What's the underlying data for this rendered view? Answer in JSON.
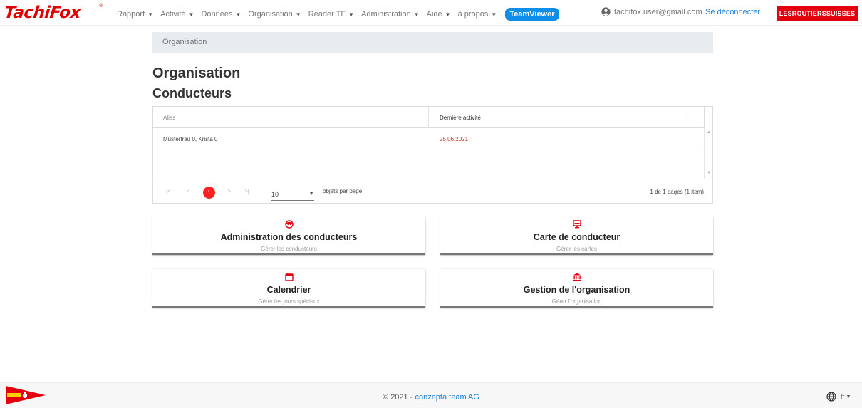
{
  "app": {
    "logo_text": "TachiFox",
    "logo_mark": "®"
  },
  "nav": {
    "items": [
      {
        "label": "Rapport"
      },
      {
        "label": "Activité"
      },
      {
        "label": "Données"
      },
      {
        "label": "Organisation"
      },
      {
        "label": "Reader TF"
      },
      {
        "label": "Administration"
      },
      {
        "label": "Aide"
      },
      {
        "label": "à propos"
      }
    ],
    "teamviewer": "TeamViewer",
    "user_email": "tachifox.user@gmail.com",
    "logout": "Se déconnecter",
    "organisation_badge": "LESROUTIERSSUISSES"
  },
  "breadcrumb": {
    "current": "Organisation"
  },
  "page": {
    "title": "Organisation",
    "subtitle": "Conducteurs"
  },
  "grid": {
    "columns": [
      {
        "label": "Alias"
      },
      {
        "label": "Dernière activité",
        "sort": "↑"
      }
    ],
    "rows": [
      {
        "alias": "Musterfrau 0, Krista 0",
        "last_activity": "25.06.2021"
      }
    ],
    "pager": {
      "first": "|<",
      "prev": "<",
      "current_page": "1",
      "next": ">",
      "last": ">|",
      "page_size": "10",
      "page_size_label": "objets par page",
      "info": "1 de 1 pages (1 item)"
    }
  },
  "tiles": [
    {
      "icon": "driver-face-icon",
      "title": "Administration des conducteurs",
      "subtitle": "Gérer les conducteurs"
    },
    {
      "icon": "driver-card-icon",
      "title": "Carte de conducteur",
      "subtitle": "Gérer les cartes"
    },
    {
      "icon": "calendar-icon",
      "title": "Calendrier",
      "subtitle": "Gérer les jours spéciaux"
    },
    {
      "icon": "institution-icon",
      "title": "Gestion de l'organisation",
      "subtitle": "Gérer l'organisation"
    }
  ],
  "footer": {
    "copyright": "© 2021 - ",
    "company": "conzepta team AG",
    "language": "fr"
  },
  "colors": {
    "accent": "#e3000f",
    "link": "#1e7fd8",
    "teamviewer": "#0e8ee9"
  }
}
